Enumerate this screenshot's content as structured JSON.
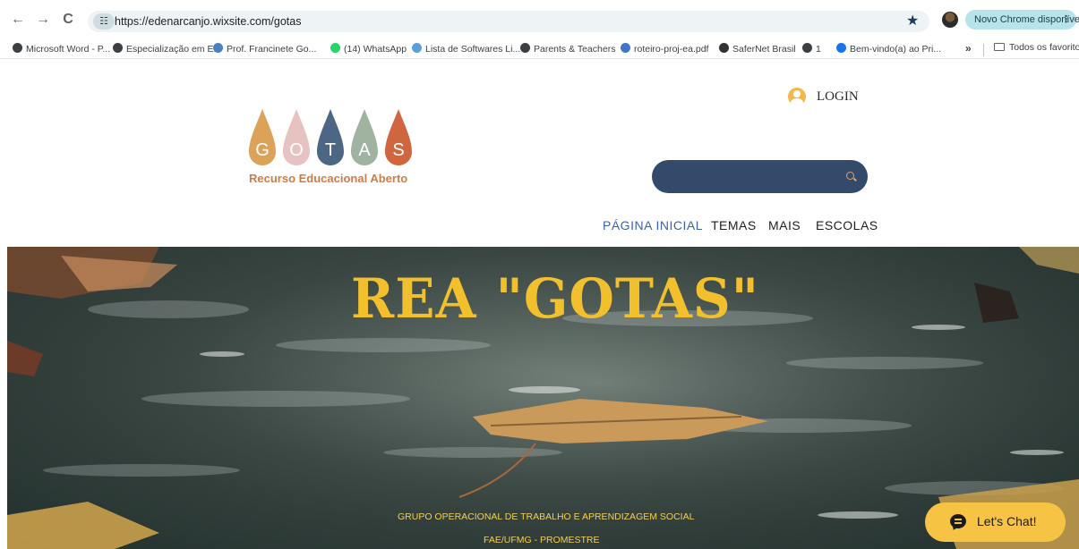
{
  "browser": {
    "url": "https://edenarcanjo.wixsite.com/gotas",
    "update_chip": "Novo Chrome disponível",
    "menu_glyph": "⋮",
    "bookmarks": [
      {
        "label": "Microsoft Word - P...",
        "icon": "globe-icon",
        "color": "#3c4043"
      },
      {
        "label": "Especialização em E...",
        "icon": "globe-icon",
        "color": "#3c4043"
      },
      {
        "label": "Prof. Francinete Go...",
        "icon": "site-icon",
        "color": "#4a7fc1"
      },
      {
        "label": "(14) WhatsApp",
        "icon": "whatsapp-icon",
        "color": "#25d366"
      },
      {
        "label": "Lista de Softwares Li...",
        "icon": "wordpress-icon",
        "color": "#5aa0d8"
      },
      {
        "label": "Parents & Teachers",
        "icon": "globe-icon",
        "color": "#3c4043"
      },
      {
        "label": "roteiro-proj-ea.pdf",
        "icon": "pdf-icon",
        "color": "#3f76c8"
      },
      {
        "label": "SaferNet Brasil",
        "icon": "safernet-icon",
        "color": "#333333"
      },
      {
        "label": "1",
        "icon": "globe-icon",
        "color": "#3c4043"
      },
      {
        "label": "Bem-vindo(a) ao Pri...",
        "icon": "play-icon",
        "color": "#1a73e8"
      }
    ],
    "overflow": "»",
    "all_bookmarks": "Todos os favoritos"
  },
  "header": {
    "login": "LOGIN",
    "logo_letters": [
      {
        "letter": "G",
        "color": "#dba35a"
      },
      {
        "letter": "O",
        "color": "#e6c3c1"
      },
      {
        "letter": "T",
        "color": "#4d6683"
      },
      {
        "letter": "A",
        "color": "#9fb3a0"
      },
      {
        "letter": "S",
        "color": "#d0663f"
      }
    ],
    "tagline": "Recurso Educacional Aberto"
  },
  "nav": {
    "home": "PÁGINA INICIAL",
    "temas": "TEMAS",
    "mais": "MAIS",
    "escolas": "ESCOLAS"
  },
  "hero": {
    "title": "REA \"GOTAS\"",
    "subtitle1": "GRUPO OPERACIONAL DE TRABALHO E APRENDIZAGEM SOCIAL",
    "subtitle2": "FAE/UFMG  - PROMESTRE"
  },
  "chat": {
    "label": "Let's Chat!"
  },
  "colors": {
    "accent_nav": "#3b63a8",
    "search_bg": "#344a6a",
    "title_yellow": "#f2bf2d",
    "chat_yellow": "#f6c344"
  }
}
